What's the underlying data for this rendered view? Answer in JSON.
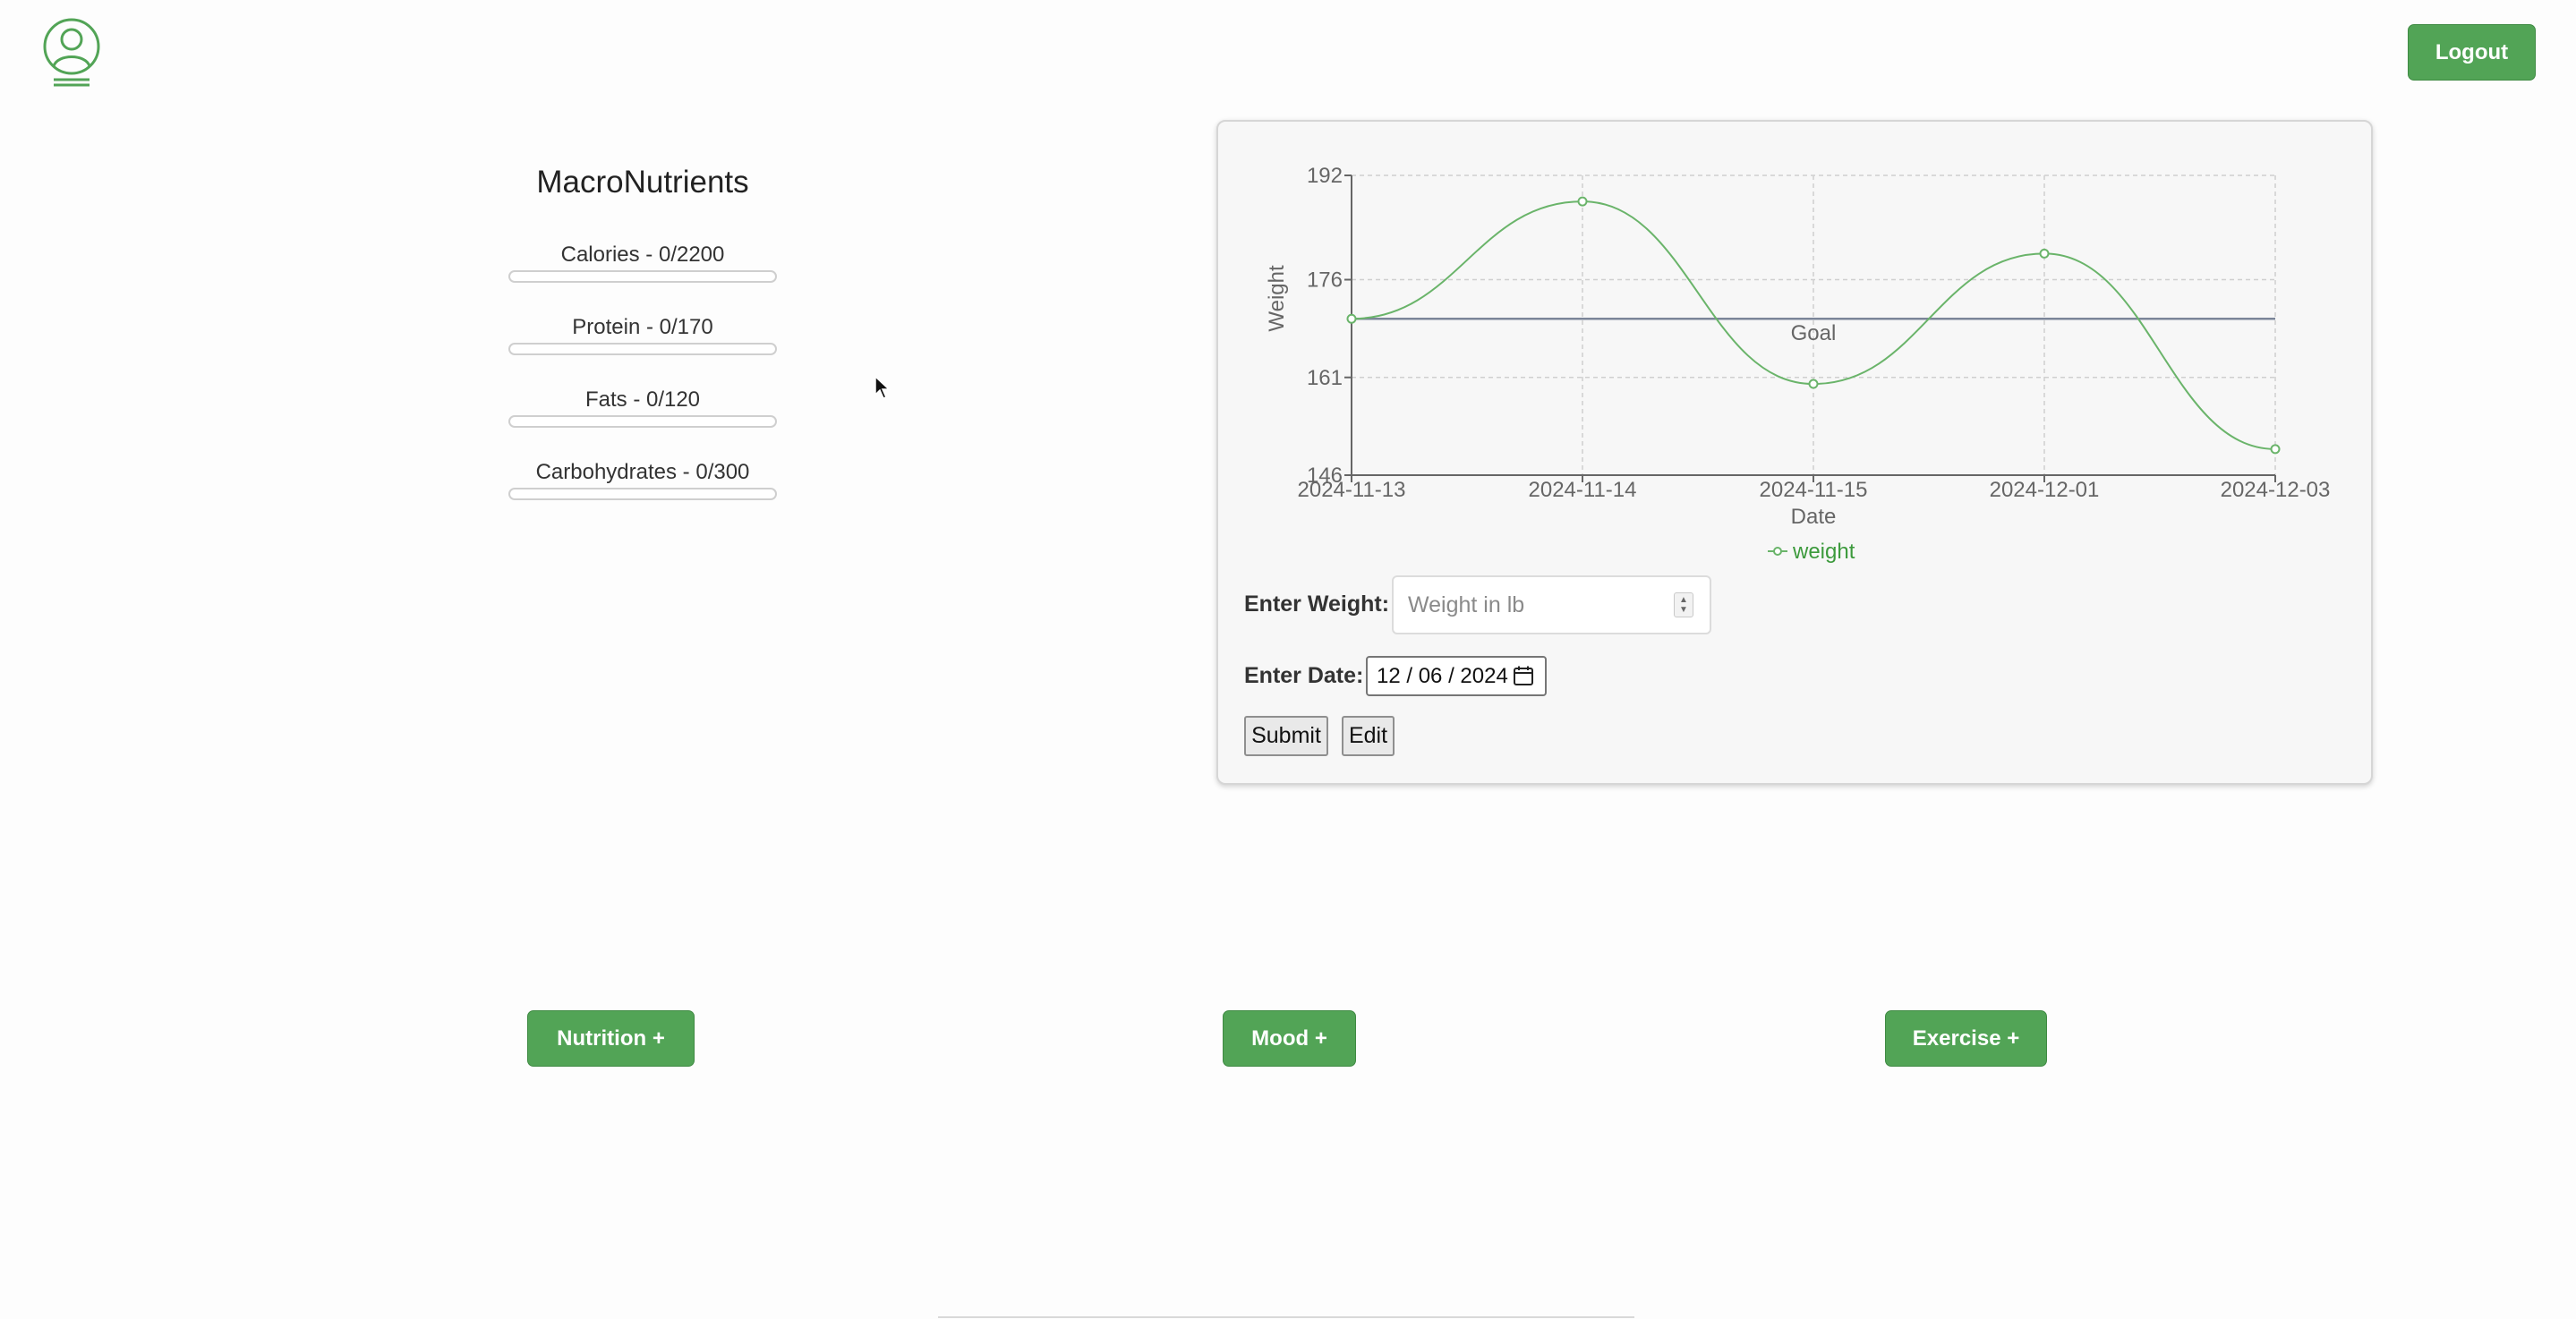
{
  "header": {
    "logout_label": "Logout"
  },
  "macros": {
    "title": "MacroNutrients",
    "items": [
      {
        "label": "Calories - 0/2200",
        "progress": 0
      },
      {
        "label": "Protein - 0/170",
        "progress": 0
      },
      {
        "label": "Fats - 0/120",
        "progress": 0
      },
      {
        "label": "Carbohydrates - 0/300",
        "progress": 0
      }
    ]
  },
  "weight_form": {
    "weight_label": "Enter Weight:",
    "weight_placeholder": "Weight in lb",
    "date_label": "Enter Date:",
    "date_value": "12 / 06 / 2024",
    "submit_label": "Submit",
    "edit_label": "Edit"
  },
  "chart_data": {
    "type": "line",
    "x": [
      "2024-11-13",
      "2024-11-14",
      "2024-11-15",
      "2024-12-01",
      "2024-12-03"
    ],
    "series": [
      {
        "name": "weight",
        "values": [
          170,
          188,
          160,
          180,
          150
        ]
      }
    ],
    "goal": {
      "label": "Goal",
      "value": 170
    },
    "xlabel": "Date",
    "ylabel": "Weight",
    "yticks": [
      146,
      161,
      176,
      192
    ],
    "ylim": [
      146,
      192
    ],
    "grid": true,
    "legend": "bottom",
    "colors": {
      "series": "#6ab46a",
      "goal": "#7b8598",
      "axis": "#666666"
    }
  },
  "actions": {
    "nutrition_label": "Nutrition +",
    "mood_label": "Mood +",
    "exercise_label": "Exercise +"
  },
  "colors": {
    "brand_green": "#52a456"
  },
  "icons": {
    "avatar": "user-circle-icon",
    "cursor": "mouse-pointer-icon",
    "calendar": "calendar-icon",
    "spinner": "number-spinner-icon"
  }
}
